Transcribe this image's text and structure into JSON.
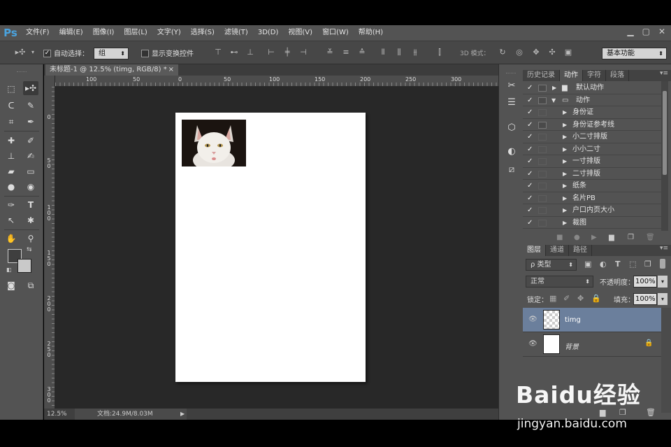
{
  "app": {
    "logo": "Ps",
    "window_buttons": [
      "▁",
      "▢",
      "✕"
    ]
  },
  "menu": [
    "文件(F)",
    "编辑(E)",
    "图像(I)",
    "图层(L)",
    "文字(Y)",
    "选择(S)",
    "滤镜(T)",
    "3D(D)",
    "视图(V)",
    "窗口(W)",
    "帮助(H)"
  ],
  "options": {
    "auto_select_label": "自动选择：",
    "auto_select_value": "组",
    "show_transform_label": "显示变换控件",
    "mode_3d_label": "3D 模式：",
    "workspace": "基本功能"
  },
  "document": {
    "tab_title": "未标题-1 @ 12.5% (timg, RGB/8) *",
    "close": "×"
  },
  "ruler_top": [
    "100",
    "50",
    "0",
    "50",
    "100",
    "150",
    "200",
    "250",
    "300"
  ],
  "ruler_left": [
    [
      "0"
    ],
    [
      "5",
      "0"
    ],
    [
      "1",
      "0",
      "0"
    ],
    [
      "1",
      "5",
      "0"
    ],
    [
      "2",
      "0",
      "0"
    ],
    [
      "2",
      "5",
      "0"
    ],
    [
      "3",
      "0",
      "0"
    ]
  ],
  "status": {
    "zoom": "12.5%",
    "doc": "文档:24.9M/8.03M"
  },
  "actions_panel": {
    "tabs": [
      "历史记录",
      "动作",
      "字符",
      "段落"
    ],
    "active_tab": "动作",
    "items": [
      {
        "label": "默认动作",
        "type": "set",
        "expanded": false
      },
      {
        "label": "动作",
        "type": "set",
        "expanded": true
      },
      {
        "label": "身份证",
        "type": "action"
      },
      {
        "label": "身份证参考线",
        "type": "action"
      },
      {
        "label": "小二寸排版",
        "type": "action"
      },
      {
        "label": "小小二寸",
        "type": "action"
      },
      {
        "label": "一寸排版",
        "type": "action"
      },
      {
        "label": "二寸排版",
        "type": "action"
      },
      {
        "label": "纸条",
        "type": "action"
      },
      {
        "label": "名片PB",
        "type": "action"
      },
      {
        "label": "户口内页大小",
        "type": "action"
      },
      {
        "label": "裁图",
        "type": "action"
      }
    ]
  },
  "layers_panel": {
    "tabs": [
      "图层",
      "通道",
      "路径"
    ],
    "active_tab": "图层",
    "filter": "ρ 类型",
    "blend_mode": "正常",
    "opacity_label": "不透明度：",
    "opacity": "100%",
    "lock_label": "锁定：",
    "fill_label": "填充：",
    "fill": "100%",
    "layers": [
      {
        "name": "timg",
        "selected": true
      },
      {
        "name": "背景",
        "selected": false,
        "locked": true
      }
    ]
  },
  "watermark": {
    "brand": "Baidu经验",
    "url": "jingyan.baidu.com"
  }
}
